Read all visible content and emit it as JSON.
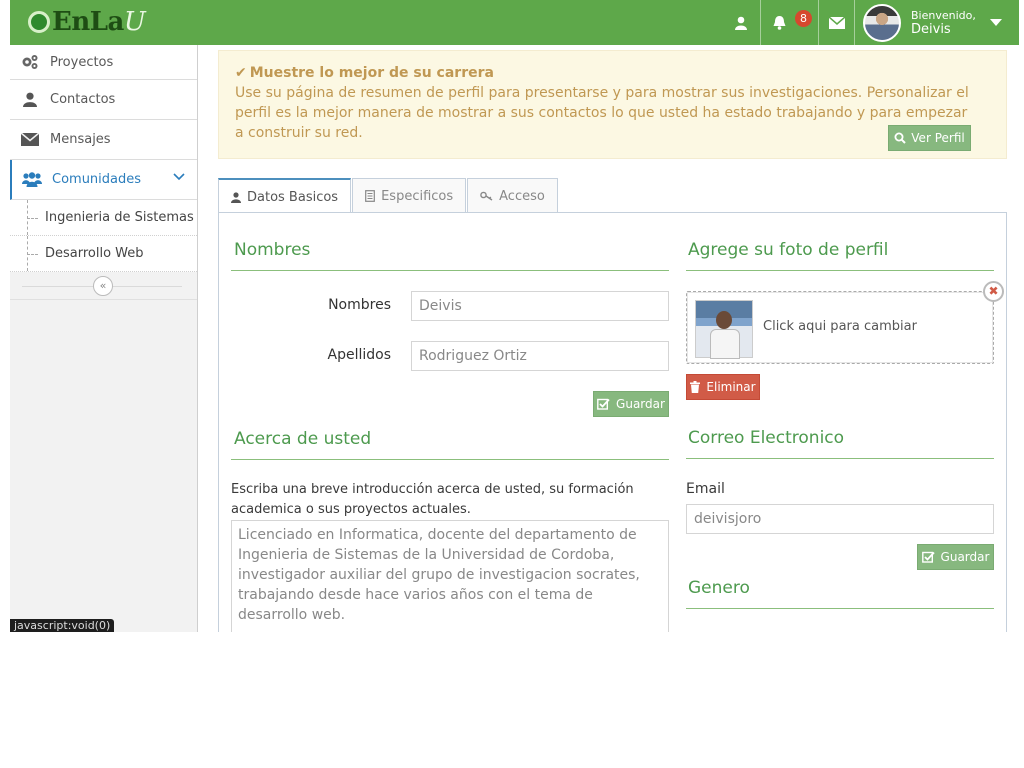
{
  "header": {
    "logo": {
      "prefix": "EnLa",
      "suffix": "U"
    },
    "notifications_count": "8",
    "welcome_label": "Bienvenido,",
    "user_name": "Deivis"
  },
  "sidebar": {
    "items": [
      {
        "label": "Proyectos",
        "icon": "gears-icon"
      },
      {
        "label": "Contactos",
        "icon": "user-icon"
      },
      {
        "label": "Mensajes",
        "icon": "envelope-icon"
      },
      {
        "label": "Comunidades",
        "icon": "users-icon",
        "active": true
      }
    ],
    "subitems": [
      {
        "label": "Ingenieria de Sistemas"
      },
      {
        "label": "Desarrollo Web"
      }
    ]
  },
  "status_bar": "javascript:void(0)",
  "alert": {
    "title": "Muestre lo mejor de su carrera",
    "text": "Use su página de resumen de perfil para presentarse y para mostrar sus investigaciones. Personalizar el perfil es la mejor manera de mostrar a sus contactos lo que usted ha estado trabajando y para empezar a construir su red.",
    "button": "Ver Perfil"
  },
  "tabs": [
    {
      "label": "Datos Basicos",
      "active": true
    },
    {
      "label": "Especificos"
    },
    {
      "label": "Acceso"
    }
  ],
  "names_section": {
    "title": "Nombres",
    "first_name_label": "Nombres",
    "first_name_value": "Deivis",
    "last_name_label": "Apellidos",
    "last_name_value": "Rodriguez Ortiz",
    "save": "Guardar"
  },
  "photo_section": {
    "title": "Agrege su foto de perfil",
    "caption": "Click aqui para cambiar",
    "delete": "Eliminar"
  },
  "about_section": {
    "title": "Acerca de usted",
    "intro": "Escriba una breve introducción acerca de usted, su formación academica o sus proyectos actuales.",
    "value": "Licenciado en Informatica, docente del departamento de Ingenieria de Sistemas de la Universidad de Cordoba, investigador auxiliar del grupo de investigacion socrates, trabajando desde hace varios años con el tema de desarrollo web."
  },
  "email_section": {
    "title": "Correo Electronico",
    "label": "Email",
    "value": "deivisjoro",
    "save": "Guardar"
  },
  "gender_section": {
    "title": "Genero"
  },
  "colors": {
    "brand": "#5ea84a",
    "accent_blue": "#2b7dbc",
    "danger": "#d15b47",
    "warning_text": "#c09853"
  }
}
